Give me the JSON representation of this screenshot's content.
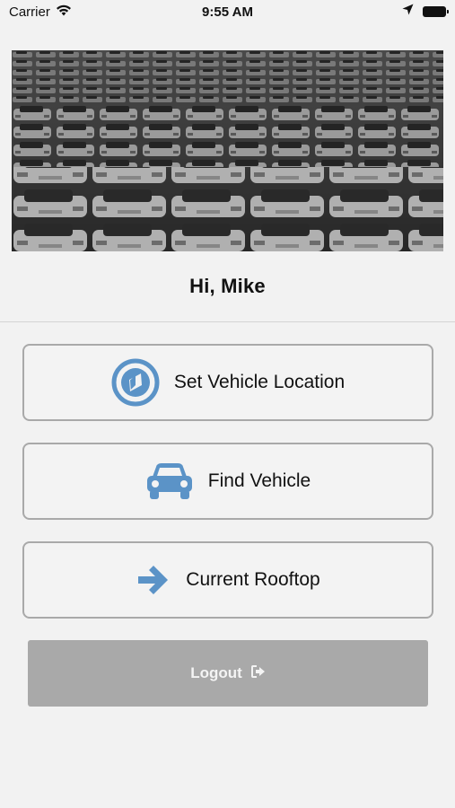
{
  "status_bar": {
    "carrier": "Carrier",
    "time": "9:55 AM"
  },
  "hero": {
    "image": "car-lot-photo-grayscale"
  },
  "greeting": "Hi, Mike",
  "menu": {
    "set_location_label": "Set Vehicle Location",
    "find_vehicle_label": "Find Vehicle",
    "current_rooftop_label": "Current Rooftop"
  },
  "logout": {
    "label": "Logout",
    "icon": "sign-out-icon"
  },
  "colors": {
    "accent": "#5b93c7",
    "background": "#f2f2f2",
    "logout_background": "#a9a9a9",
    "button_border": "#a9a9a9"
  }
}
